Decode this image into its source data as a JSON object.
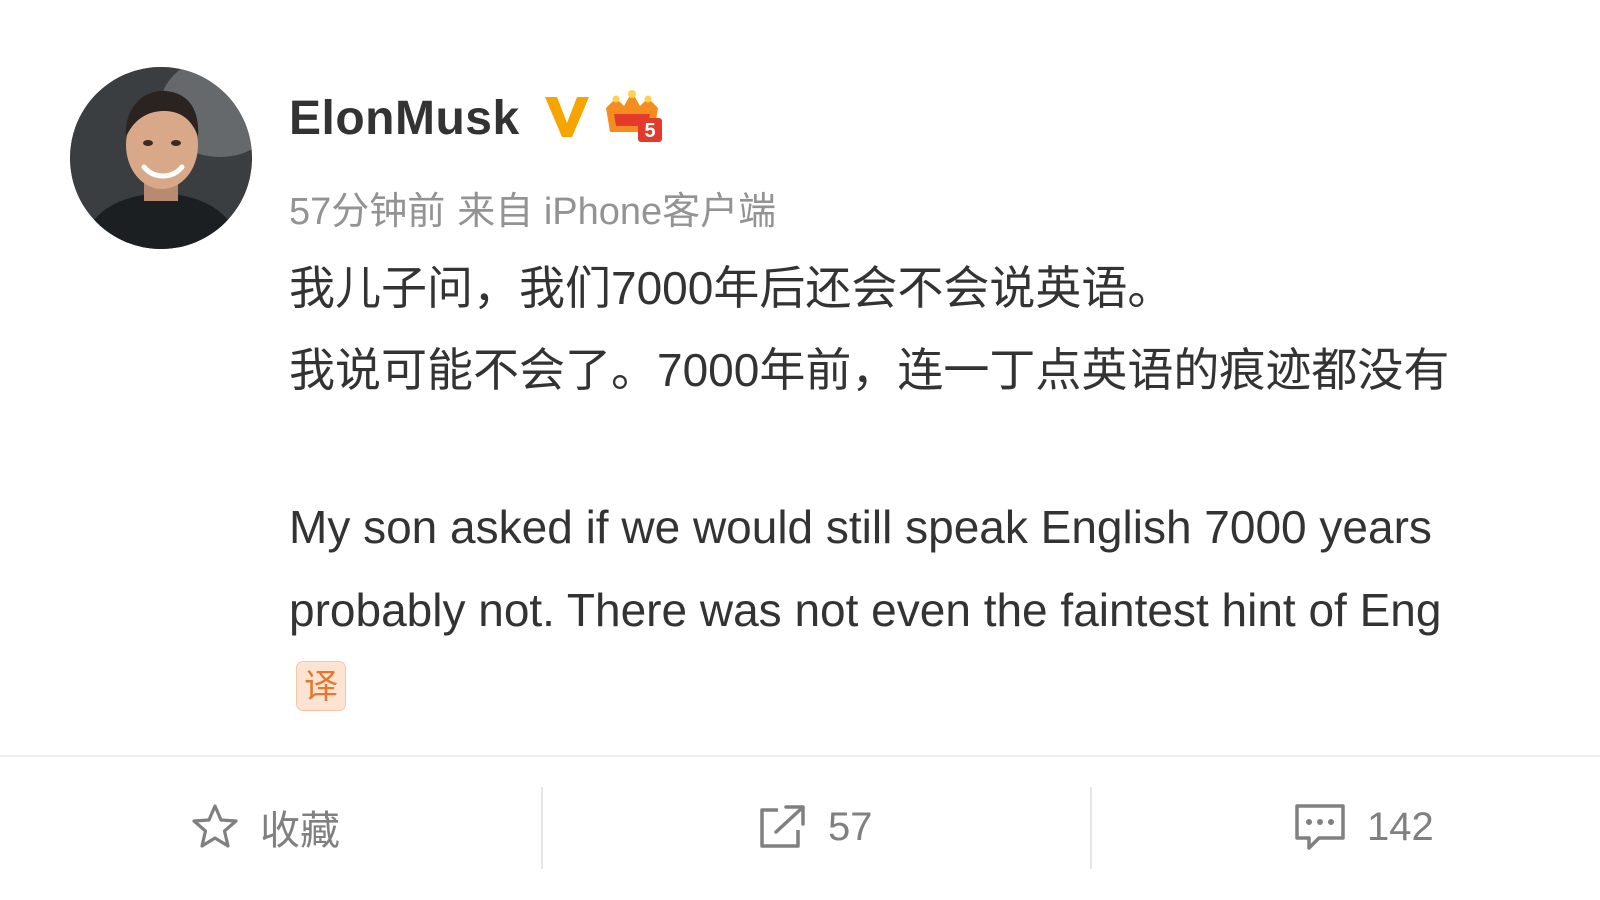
{
  "user": {
    "name": "ElonMusk",
    "badge_vip_level": "5"
  },
  "meta": {
    "time": "57分钟前",
    "source": "来自 iPhone客户端"
  },
  "post": {
    "lines": [
      "我儿子问，我们7000年后还会不会说英语。",
      "我说可能不会了。7000年前，连一丁点英语的痕迹都没有",
      "My son asked if we would still speak English 7000 years",
      "probably not. There was not even the faintest hint of Eng"
    ],
    "translate_label": "译"
  },
  "toolbar": {
    "favorite_label": "收藏",
    "repost_count": "57",
    "comment_count": "142"
  },
  "colors": {
    "username": "#333333",
    "meta": "#939393",
    "verified": "#f5a400",
    "translate_bg": "#fde4d2",
    "translate_fg": "#e8762d",
    "toolbar_text": "#808080"
  },
  "icons": {
    "verified": "verified-v-icon",
    "vip": "vip-crown-icon",
    "favorite": "star-icon",
    "repost": "share-arrow-icon",
    "comment": "comment-bubble-icon"
  }
}
